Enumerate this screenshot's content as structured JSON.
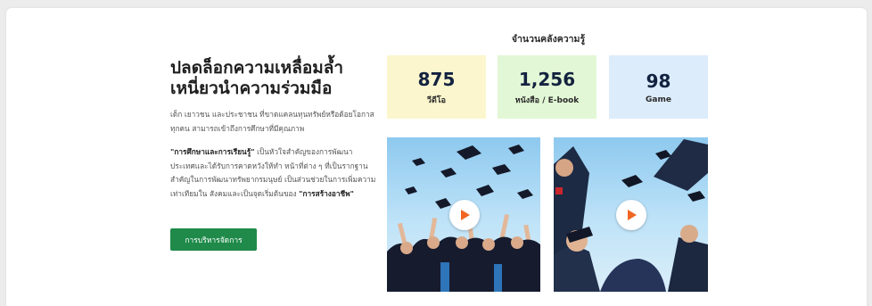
{
  "hero": {
    "title_line1": "ปลดล็อกความเหลื่อมล้ำ",
    "title_line2": "เหนี่ยวนำความร่วมมือ",
    "intro": "เด็ก เยาวชน และประชาชน ที่ขาดแคลนทุนทรัพย์หรือด้อยโอกาสทุกคน สามารถเข้าถึงการศึกษาที่มีคุณภาพ",
    "body_bold1": "\"การศึกษาและการเรียนรู้\"",
    "body_text1": " เป็นหัวใจสำคัญของการพัฒนาประเทศและได้รับการคาดหวังให้ทำ หน้าที่ต่าง ๆ ที่เป็นรากฐานสำคัญในการพัฒนาทรัพยากรมนุษย์ เป็นส่วนช่วยในการเพิ่มความเท่าเทียมใน สังคมและเป็นจุดเริ่มต้นของ ",
    "body_bold2": "\"การสร้างอาชีพ\"",
    "cta_label": "การบริหารจัดการ"
  },
  "stats": {
    "heading": "จำนวนคลังความรู้",
    "items": [
      {
        "value": "875",
        "label": "วีดีโอ",
        "color": "#fbf6cd"
      },
      {
        "value": "1,256",
        "label": "หนังสือ / E-book",
        "color": "#e2f7d5"
      },
      {
        "value": "98",
        "label": "Game",
        "color": "#dcecfb"
      }
    ]
  },
  "media": {
    "accent": "#f26522",
    "cta_color": "#1f8a4a"
  }
}
